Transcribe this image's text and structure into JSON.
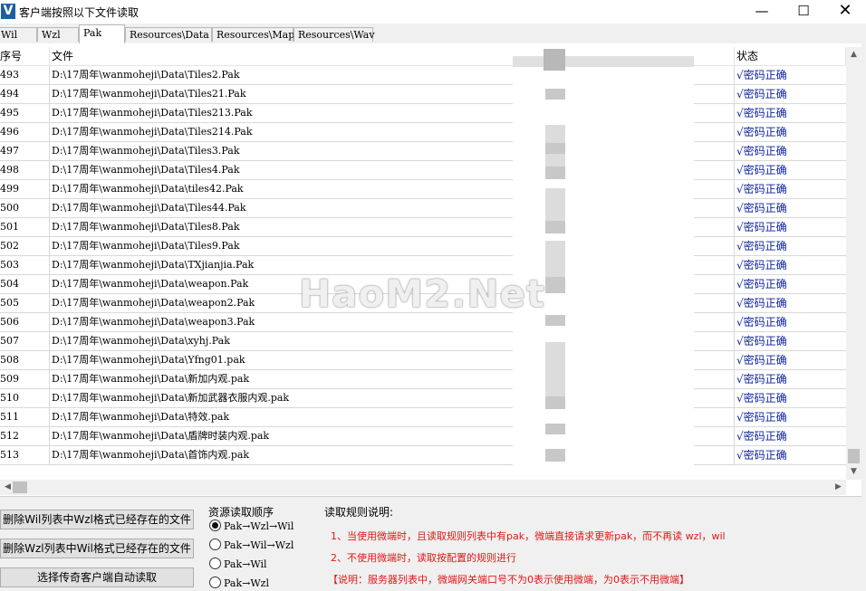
{
  "window": {
    "icon_letter": "V",
    "title": "客户端按照以下文件读取",
    "min_glyph": "—",
    "max_glyph": "☐",
    "close_glyph": "✕"
  },
  "tabs": [
    {
      "label": "Wil"
    },
    {
      "label": "Wzl"
    },
    {
      "label": "Pak",
      "active": true
    },
    {
      "label": "Resources\\Data"
    },
    {
      "label": "Resources\\Map"
    },
    {
      "label": "Resources\\Wav"
    }
  ],
  "list": {
    "columns": {
      "index": "序号",
      "file": "文件",
      "status": "状态"
    },
    "rows": [
      {
        "idx": "493",
        "file": "D:\\17周年\\wanmoheji\\Data\\Tiles2.Pak",
        "status": "√密码正确"
      },
      {
        "idx": "494",
        "file": "D:\\17周年\\wanmoheji\\Data\\Tiles21.Pak",
        "status": "√密码正确"
      },
      {
        "idx": "495",
        "file": "D:\\17周年\\wanmoheji\\Data\\Tiles213.Pak",
        "status": "√密码正确"
      },
      {
        "idx": "496",
        "file": "D:\\17周年\\wanmoheji\\Data\\Tiles214.Pak",
        "status": "√密码正确"
      },
      {
        "idx": "497",
        "file": "D:\\17周年\\wanmoheji\\Data\\Tiles3.Pak",
        "status": "√密码正确"
      },
      {
        "idx": "498",
        "file": "D:\\17周年\\wanmoheji\\Data\\Tiles4.Pak",
        "status": "√密码正确"
      },
      {
        "idx": "499",
        "file": "D:\\17周年\\wanmoheji\\Data\\tiles42.Pak",
        "status": "√密码正确"
      },
      {
        "idx": "500",
        "file": "D:\\17周年\\wanmoheji\\Data\\Tiles44.Pak",
        "status": "√密码正确"
      },
      {
        "idx": "501",
        "file": "D:\\17周年\\wanmoheji\\Data\\Tiles8.Pak",
        "status": "√密码正确"
      },
      {
        "idx": "502",
        "file": "D:\\17周年\\wanmoheji\\Data\\Tiles9.Pak",
        "status": "√密码正确"
      },
      {
        "idx": "503",
        "file": "D:\\17周年\\wanmoheji\\Data\\TXjianjia.Pak",
        "status": "√密码正确"
      },
      {
        "idx": "504",
        "file": "D:\\17周年\\wanmoheji\\Data\\weapon.Pak",
        "status": "√密码正确"
      },
      {
        "idx": "505",
        "file": "D:\\17周年\\wanmoheji\\Data\\weapon2.Pak",
        "status": "√密码正确"
      },
      {
        "idx": "506",
        "file": "D:\\17周年\\wanmoheji\\Data\\weapon3.Pak",
        "status": "√密码正确"
      },
      {
        "idx": "507",
        "file": "D:\\17周年\\wanmoheji\\Data\\xyhj.Pak",
        "status": "√密码正确"
      },
      {
        "idx": "508",
        "file": "D:\\17周年\\wanmoheji\\Data\\Yfng01.pak",
        "status": "√密码正确"
      },
      {
        "idx": "509",
        "file": "D:\\17周年\\wanmoheji\\Data\\新加内观.pak",
        "status": "√密码正确"
      },
      {
        "idx": "510",
        "file": "D:\\17周年\\wanmoheji\\Data\\新加武器衣服内观.pak",
        "status": "√密码正确"
      },
      {
        "idx": "511",
        "file": "D:\\17周年\\wanmoheji\\Data\\特效.pak",
        "status": "√密码正确"
      },
      {
        "idx": "512",
        "file": "D:\\17周年\\wanmoheji\\Data\\盾牌时装内观.pak",
        "status": "√密码正确"
      },
      {
        "idx": "513",
        "file": "D:\\17周年\\wanmoheji\\Data\\首饰内观.pak",
        "status": "√密码正确"
      }
    ]
  },
  "scrollbars": {
    "up": "▲",
    "down": "▼",
    "left": "◀",
    "right": "▶"
  },
  "actions": {
    "delete_wil": "删除Wil列表中Wzl格式已经存在的文件",
    "delete_wzl": "删除Wzl列表中Wil格式已经存在的文件",
    "select_client": "选择传奇客户端自动读取"
  },
  "resource_order": {
    "title": "资源读取顺序",
    "options": [
      {
        "label": "Pak→Wzl→Wil",
        "selected": true
      },
      {
        "label": "Pak→Wil→Wzl",
        "selected": false
      },
      {
        "label": "Pak→Wil",
        "selected": false
      },
      {
        "label": "Pak→Wzl",
        "selected": false
      }
    ]
  },
  "rules": {
    "title": "读取规则说明:",
    "line1": "1、当使用微端时，且读取规则列表中有pak，微端直接请求更新pak，而不再读 wzl，wil",
    "line2": "2、不使用微端时，读取按配置的规则进行",
    "note": "【说明：服务器列表中，微端网关端口号不为0表示使用微端，为0表示不用微端】"
  },
  "watermark": "HaoM2.Net"
}
